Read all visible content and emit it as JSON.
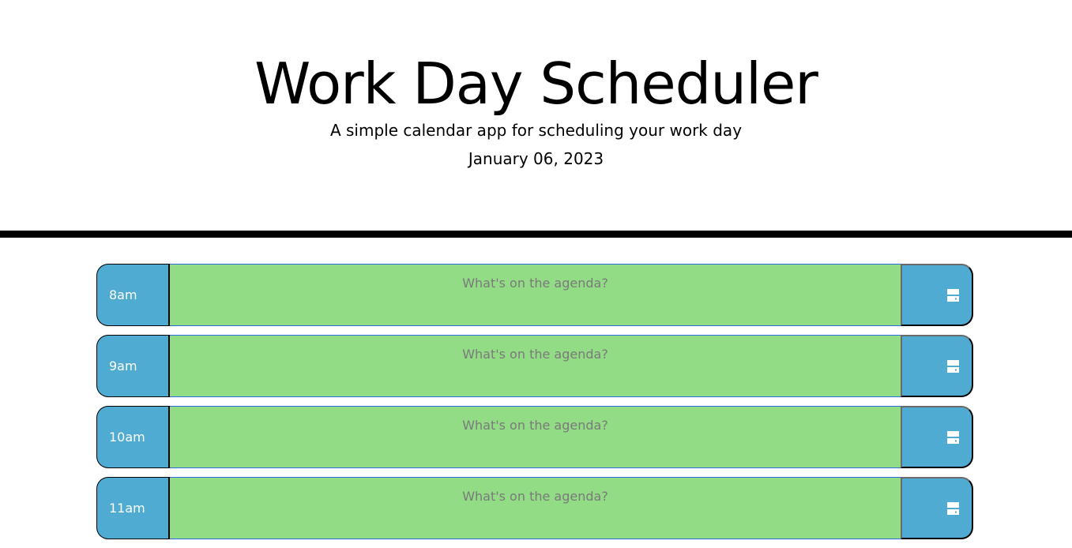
{
  "header": {
    "title": "Work Day Scheduler",
    "subtitle": "A simple calendar app for scheduling your work day",
    "current_date": "January 06, 2023"
  },
  "time_blocks": [
    {
      "hour": "8am",
      "placeholder": "What's on the agenda?",
      "value": "",
      "save_icon": "save-icon"
    },
    {
      "hour": "9am",
      "placeholder": "What's on the agenda?",
      "value": "",
      "save_icon": "save-icon"
    },
    {
      "hour": "10am",
      "placeholder": "What's on the agenda?",
      "value": "",
      "save_icon": "save-icon"
    },
    {
      "hour": "11am",
      "placeholder": "What's on the agenda?",
      "value": "",
      "save_icon": "save-icon"
    }
  ],
  "colors": {
    "hour_bg": "#4fabd1",
    "future_bg": "#92dc86",
    "header_border": "#000000",
    "placeholder_text": "#7a7a7a"
  }
}
